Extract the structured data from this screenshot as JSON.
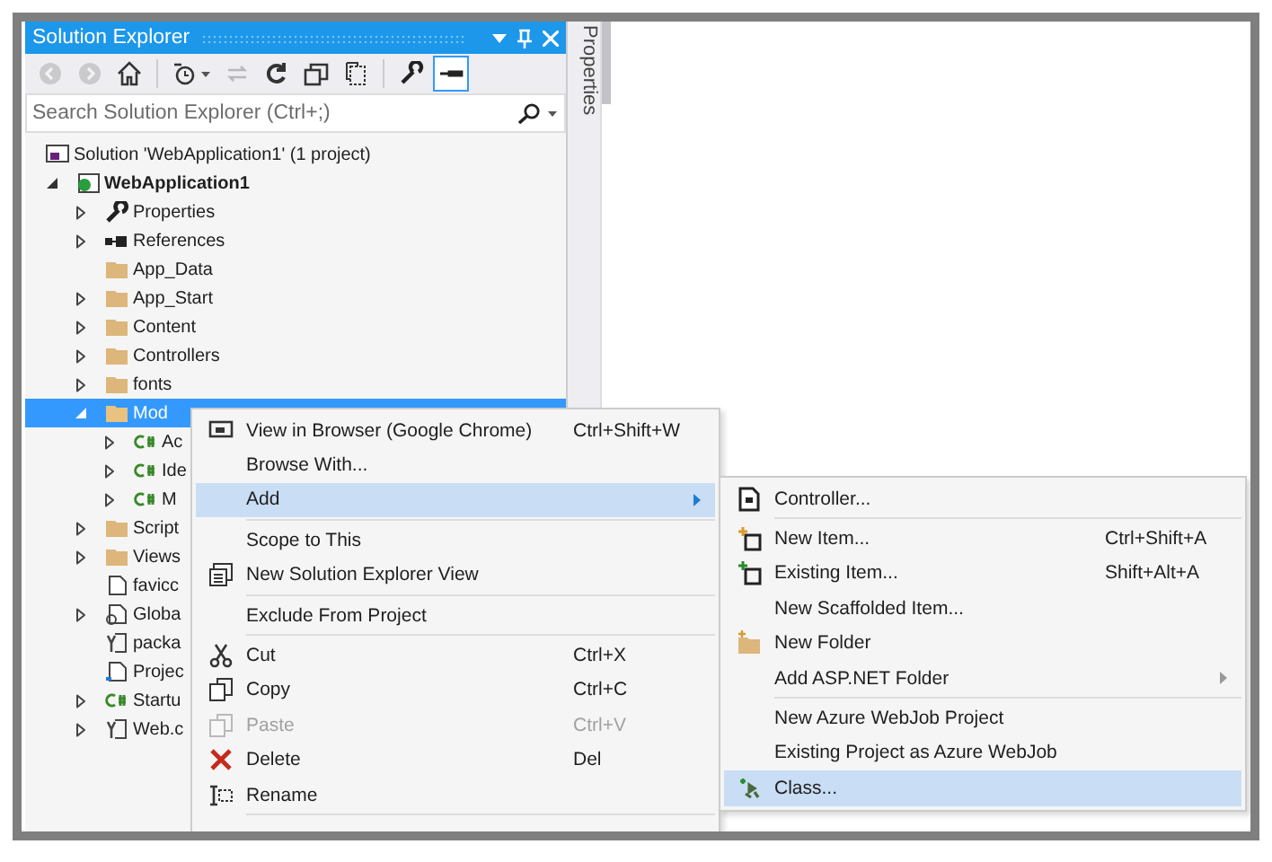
{
  "panel": {
    "title": "Solution Explorer",
    "search": {
      "placeholder": "Search Solution Explorer (Ctrl+;)"
    },
    "toolbar": [
      {
        "kind": "back",
        "disabled": true
      },
      {
        "kind": "forward",
        "disabled": true
      },
      {
        "kind": "home",
        "disabled": false
      },
      {
        "kind": "history",
        "disabled": false
      },
      {
        "kind": "sync",
        "disabled": true
      },
      {
        "kind": "refresh",
        "disabled": false
      },
      {
        "kind": "collapse",
        "disabled": false
      },
      {
        "kind": "showall",
        "disabled": false
      },
      {
        "kind": "properties",
        "disabled": false
      },
      {
        "kind": "preview",
        "disabled": false,
        "selected": true
      }
    ],
    "tree": [
      {
        "label": "Solution 'WebApplication1' (1 project)",
        "kind": "solution",
        "bold": false,
        "selected": false,
        "children": [
          {
            "label": "WebApplication1",
            "kind": "project",
            "expanded": true,
            "bold": true,
            "selected": false,
            "children": [
              {
                "label": "Properties",
                "kind": "wrench",
                "expanded": false,
                "bold": false,
                "selected": false
              },
              {
                "label": "References",
                "kind": "references",
                "expanded": false,
                "bold": false,
                "selected": false
              },
              {
                "label": "App_Data",
                "kind": "folder",
                "bold": false,
                "selected": false
              },
              {
                "label": "App_Start",
                "kind": "folder",
                "expanded": false,
                "bold": false,
                "selected": false
              },
              {
                "label": "Content",
                "kind": "folder",
                "expanded": false,
                "bold": false,
                "selected": false
              },
              {
                "label": "Controllers",
                "kind": "folder",
                "expanded": false,
                "bold": false,
                "selected": false
              },
              {
                "label": "fonts",
                "kind": "folder",
                "expanded": false,
                "bold": false,
                "selected": false
              },
              {
                "label": "Mod",
                "kind": "openfolder",
                "expanded": true,
                "bold": false,
                "selected": true,
                "children": [
                  {
                    "label": "Ac",
                    "kind": "csharp",
                    "expanded": false,
                    "bold": false,
                    "selected": false
                  },
                  {
                    "label": "Ide",
                    "kind": "csharp",
                    "expanded": false,
                    "bold": false,
                    "selected": false
                  },
                  {
                    "label": "M",
                    "kind": "csharp",
                    "expanded": false,
                    "bold": false,
                    "selected": false
                  }
                ]
              },
              {
                "label": "Script",
                "kind": "folder",
                "expanded": false,
                "bold": false,
                "selected": false
              },
              {
                "label": "Views",
                "kind": "folder",
                "expanded": false,
                "bold": false,
                "selected": false
              },
              {
                "label": "favicc",
                "kind": "file",
                "bold": false,
                "selected": false
              },
              {
                "label": "Globa",
                "kind": "global",
                "expanded": false,
                "bold": false,
                "selected": false
              },
              {
                "label": "packa",
                "kind": "config",
                "bold": false,
                "selected": false
              },
              {
                "label": "Projec",
                "kind": "readme",
                "bold": false,
                "selected": false
              },
              {
                "label": "Startu",
                "kind": "csharp",
                "expanded": false,
                "bold": false,
                "selected": false
              },
              {
                "label": "Web.c",
                "kind": "config",
                "expanded": false,
                "bold": false,
                "selected": false
              }
            ]
          }
        ]
      }
    ]
  },
  "side_tab": {
    "label": "Properties"
  },
  "context_menu": [
    {
      "kind": "browser",
      "label": "View in Browser (Google Chrome)",
      "shortcut": "Ctrl+Shift+W",
      "disabled": false,
      "submenu": false,
      "selected": false
    },
    {
      "kind": "plain",
      "label": "Browse With...",
      "disabled": false,
      "submenu": false,
      "selected": false
    },
    {
      "kind": "plain",
      "label": "Add",
      "disabled": false,
      "submenu": true,
      "selected": true
    },
    {
      "kind": "separator"
    },
    {
      "kind": "plain",
      "label": "Scope to This",
      "disabled": false,
      "submenu": false,
      "selected": false
    },
    {
      "kind": "newview",
      "label": "New Solution Explorer View",
      "disabled": false,
      "submenu": false,
      "selected": false
    },
    {
      "kind": "separator"
    },
    {
      "kind": "plain",
      "label": "Exclude From Project",
      "disabled": false,
      "submenu": false,
      "selected": false
    },
    {
      "kind": "separator"
    },
    {
      "kind": "cut",
      "label": "Cut",
      "shortcut": "Ctrl+X",
      "disabled": false,
      "submenu": false,
      "selected": false
    },
    {
      "kind": "copy",
      "label": "Copy",
      "shortcut": "Ctrl+C",
      "disabled": false,
      "submenu": false,
      "selected": false
    },
    {
      "kind": "paste",
      "label": "Paste",
      "shortcut": "Ctrl+V",
      "disabled": true,
      "submenu": false,
      "selected": false
    },
    {
      "kind": "delete",
      "label": "Delete",
      "shortcut": "Del",
      "disabled": false,
      "submenu": false,
      "selected": false
    },
    {
      "kind": "rename",
      "label": "Rename",
      "disabled": false,
      "submenu": false,
      "selected": false
    },
    {
      "kind": "separator"
    }
  ],
  "submenu": [
    {
      "kind": "controller",
      "label": "Controller...",
      "submenu": false,
      "selected": false
    },
    {
      "kind": "separator"
    },
    {
      "kind": "newitem",
      "label": "New Item...",
      "shortcut": "Ctrl+Shift+A",
      "submenu": false,
      "selected": false
    },
    {
      "kind": "existingitem",
      "label": "Existing Item...",
      "shortcut": "Shift+Alt+A",
      "submenu": false,
      "selected": false
    },
    {
      "kind": "plain",
      "label": "New Scaffolded Item...",
      "submenu": false,
      "selected": false
    },
    {
      "kind": "newfolder",
      "label": "New Folder",
      "submenu": false,
      "selected": false
    },
    {
      "kind": "plain",
      "label": "Add ASP.NET Folder",
      "submenu": true,
      "selected": false
    },
    {
      "kind": "separator"
    },
    {
      "kind": "plain",
      "label": "New Azure WebJob Project",
      "submenu": false,
      "selected": false
    },
    {
      "kind": "plain",
      "label": "Existing Project as Azure WebJob",
      "submenu": false,
      "selected": false
    },
    {
      "kind": "class",
      "label": "Class...",
      "submenu": false,
      "selected": true
    }
  ]
}
